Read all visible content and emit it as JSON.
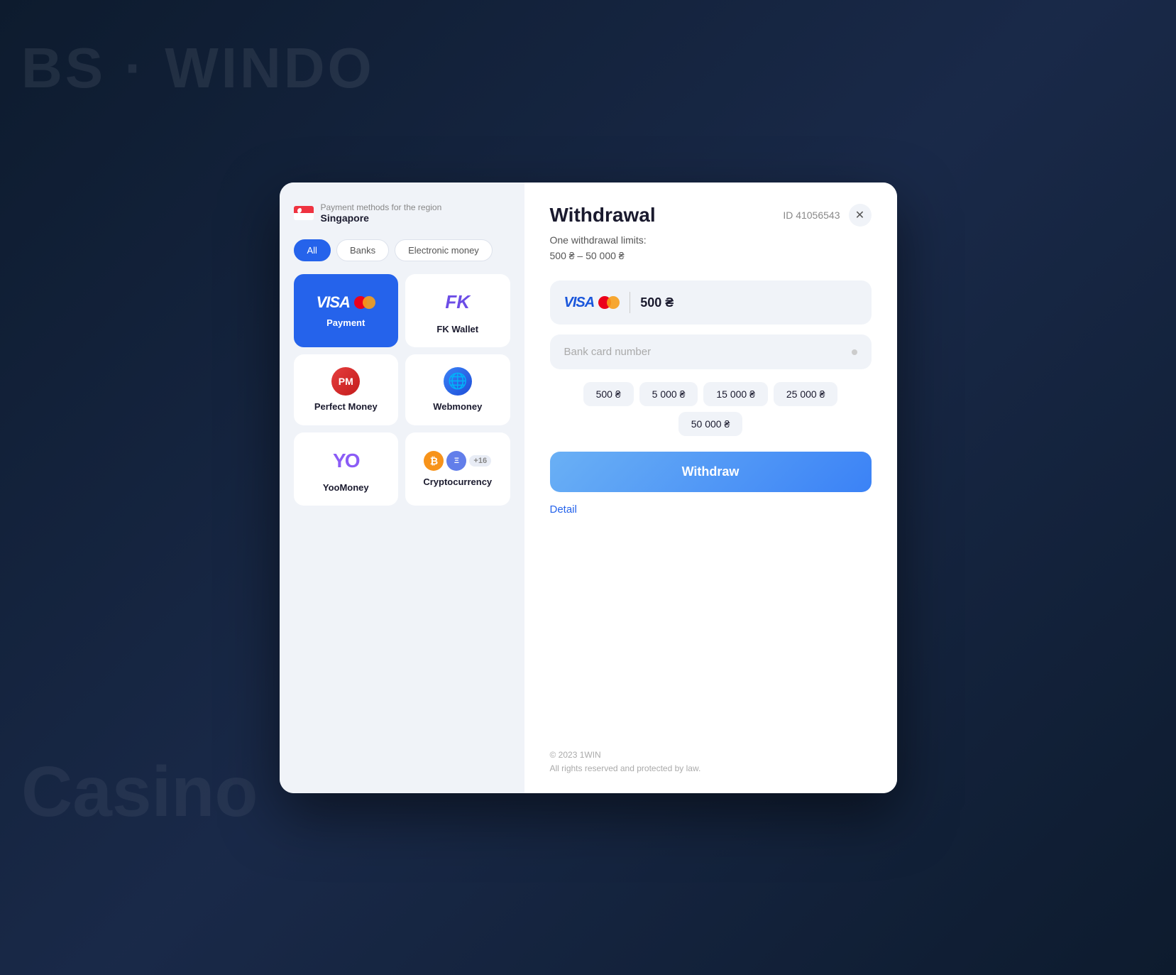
{
  "background": {
    "text": "BS · WINDO",
    "casino": "Casino"
  },
  "modal": {
    "left": {
      "region_label": "Payment methods for the region",
      "region_name": "Singapore",
      "filters": [
        {
          "id": "all",
          "label": "All",
          "active": true
        },
        {
          "id": "banks",
          "label": "Banks",
          "active": false
        },
        {
          "id": "electronic",
          "label": "Electronic money",
          "active": false
        }
      ],
      "payment_methods": [
        {
          "id": "visa",
          "label": "Payment",
          "type": "visa",
          "active": true
        },
        {
          "id": "fk-wallet",
          "label": "FK Wallet",
          "type": "fk",
          "active": false
        },
        {
          "id": "perfect-money",
          "label": "Perfect Money",
          "type": "pm",
          "active": false
        },
        {
          "id": "webmoney",
          "label": "Webmoney",
          "type": "wm",
          "active": false
        },
        {
          "id": "yoomoney",
          "label": "YooMoney",
          "type": "yoo",
          "active": false
        },
        {
          "id": "cryptocurrency",
          "label": "Cryptocurrency",
          "type": "crypto",
          "active": false
        }
      ]
    },
    "right": {
      "title": "Withdrawal",
      "id_label": "ID 41056543",
      "limits_line1": "One withdrawal limits:",
      "limits_line2": "500 ₴ – 50 000 ₴",
      "amount_display": "500 ₴",
      "card_placeholder": "Bank card number",
      "chips": [
        "500 ₴",
        "5 000 ₴",
        "15 000 ₴",
        "25 000 ₴",
        "50 000 ₴"
      ],
      "withdraw_button": "Withdraw",
      "detail_link": "Detail",
      "footer_line1": "© 2023 1WIN",
      "footer_line2": "All rights reserved and protected by law."
    }
  }
}
